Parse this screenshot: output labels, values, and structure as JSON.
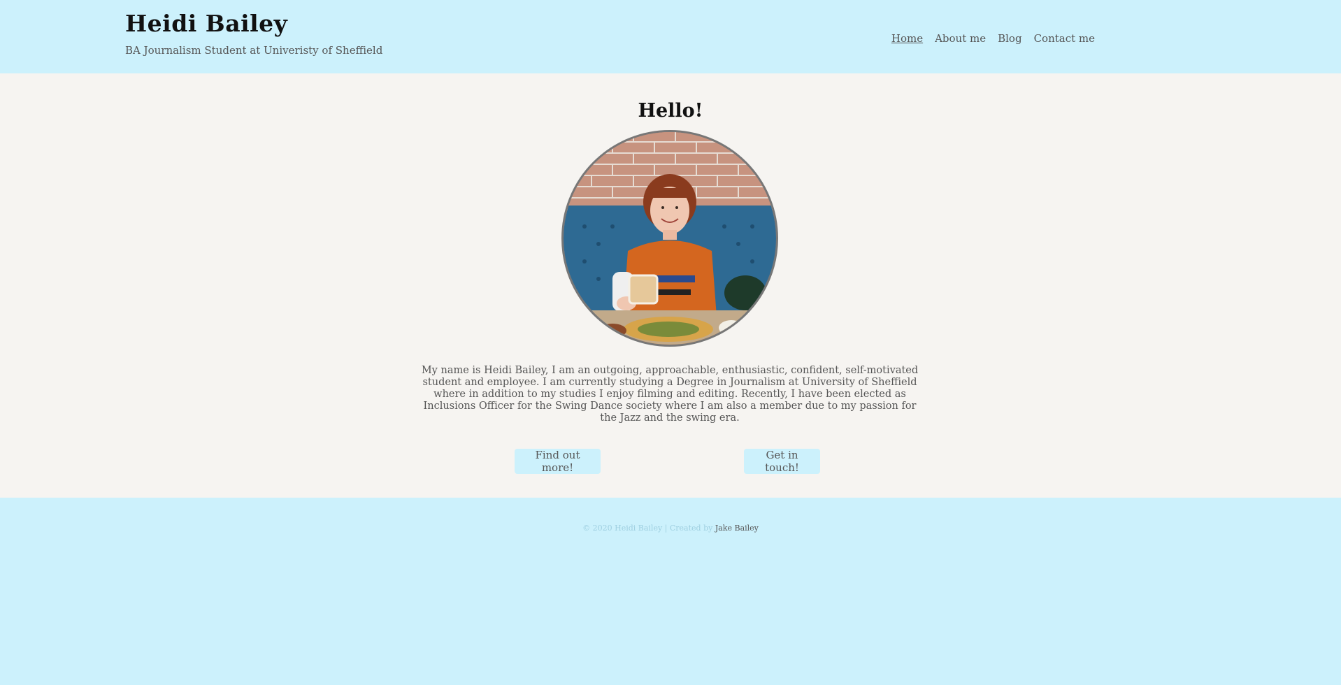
{
  "header": {
    "title": "Heidi Bailey",
    "tagline": "BA Journalism Student at Univeristy of Sheffield"
  },
  "nav": {
    "items": [
      {
        "label": "Home"
      },
      {
        "label": "About me"
      },
      {
        "label": "Blog"
      },
      {
        "label": "Contact me"
      }
    ]
  },
  "main": {
    "heading": "Hello!",
    "intro": "My name is Heidi Bailey, I am an outgoing, approachable, enthusiastic, confident, self-motivated student and employee. I am currently studying a Degree in Journalism at University of Sheffield where in addition to my studies I enjoy filming and editing. Recently, I have been elected as Inclusions Officer for the Swing Dance society where I am also a member due to my passion for the Jazz and the swing era.",
    "buttons": {
      "more": "Find out more!",
      "touch": "Get in touch!"
    }
  },
  "footer": {
    "text": "© 2020 Heidi Bailey | Created by",
    "credit_link": "Jake Bailey"
  },
  "colors": {
    "header_bg": "#ccf1fc",
    "main_bg": "#f6f4f1",
    "button_bg": "#ccf1fc",
    "title_color": "#111111",
    "text_color": "#555555"
  }
}
